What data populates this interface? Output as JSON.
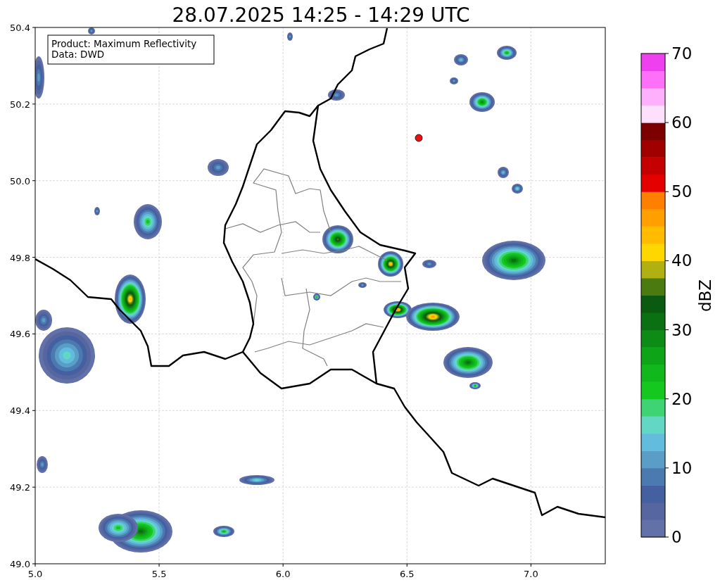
{
  "title": "28.07.2025 14:25 - 14:29 UTC",
  "info_box": [
    "Product: Maximum Reflectivity",
    "Data: DWD"
  ],
  "x_ticks": [
    "5.0",
    "5.5",
    "6.0",
    "6.5",
    "7.0"
  ],
  "y_ticks": [
    "50.4",
    "50.2",
    "50.0",
    "49.8",
    "49.6",
    "49.4",
    "49.2",
    "49.0"
  ],
  "station_marker": {
    "color": "#ee1111"
  },
  "colorbar": {
    "label": "dBZ",
    "ticks": [
      "70",
      "60",
      "50",
      "40",
      "30",
      "20",
      "10",
      "0"
    ],
    "segments": [
      {
        "color": "#6272a8"
      },
      {
        "color": "#5566a0"
      },
      {
        "color": "#4460a0"
      },
      {
        "color": "#4a7ab0"
      },
      {
        "color": "#5a9ec8"
      },
      {
        "color": "#62bcde"
      },
      {
        "color": "#62d8c4"
      },
      {
        "color": "#3ed474"
      },
      {
        "color": "#14c820"
      },
      {
        "color": "#10b81c"
      },
      {
        "color": "#0ea418"
      },
      {
        "color": "#0c8c14"
      },
      {
        "color": "#0a7012"
      },
      {
        "color": "#0a5a10"
      },
      {
        "color": "#4a7a10"
      },
      {
        "color": "#b0b010"
      },
      {
        "color": "#ffd700"
      },
      {
        "color": "#ffbb00"
      },
      {
        "color": "#ffa000"
      },
      {
        "color": "#ff8000"
      },
      {
        "color": "#e40000"
      },
      {
        "color": "#c40000"
      },
      {
        "color": "#a00000"
      },
      {
        "color": "#7c0000"
      },
      {
        "color": "#ffe0fc"
      },
      {
        "color": "#ffb0fc"
      },
      {
        "color": "#ff70f8"
      },
      {
        "color": "#ee40ee"
      }
    ]
  }
}
